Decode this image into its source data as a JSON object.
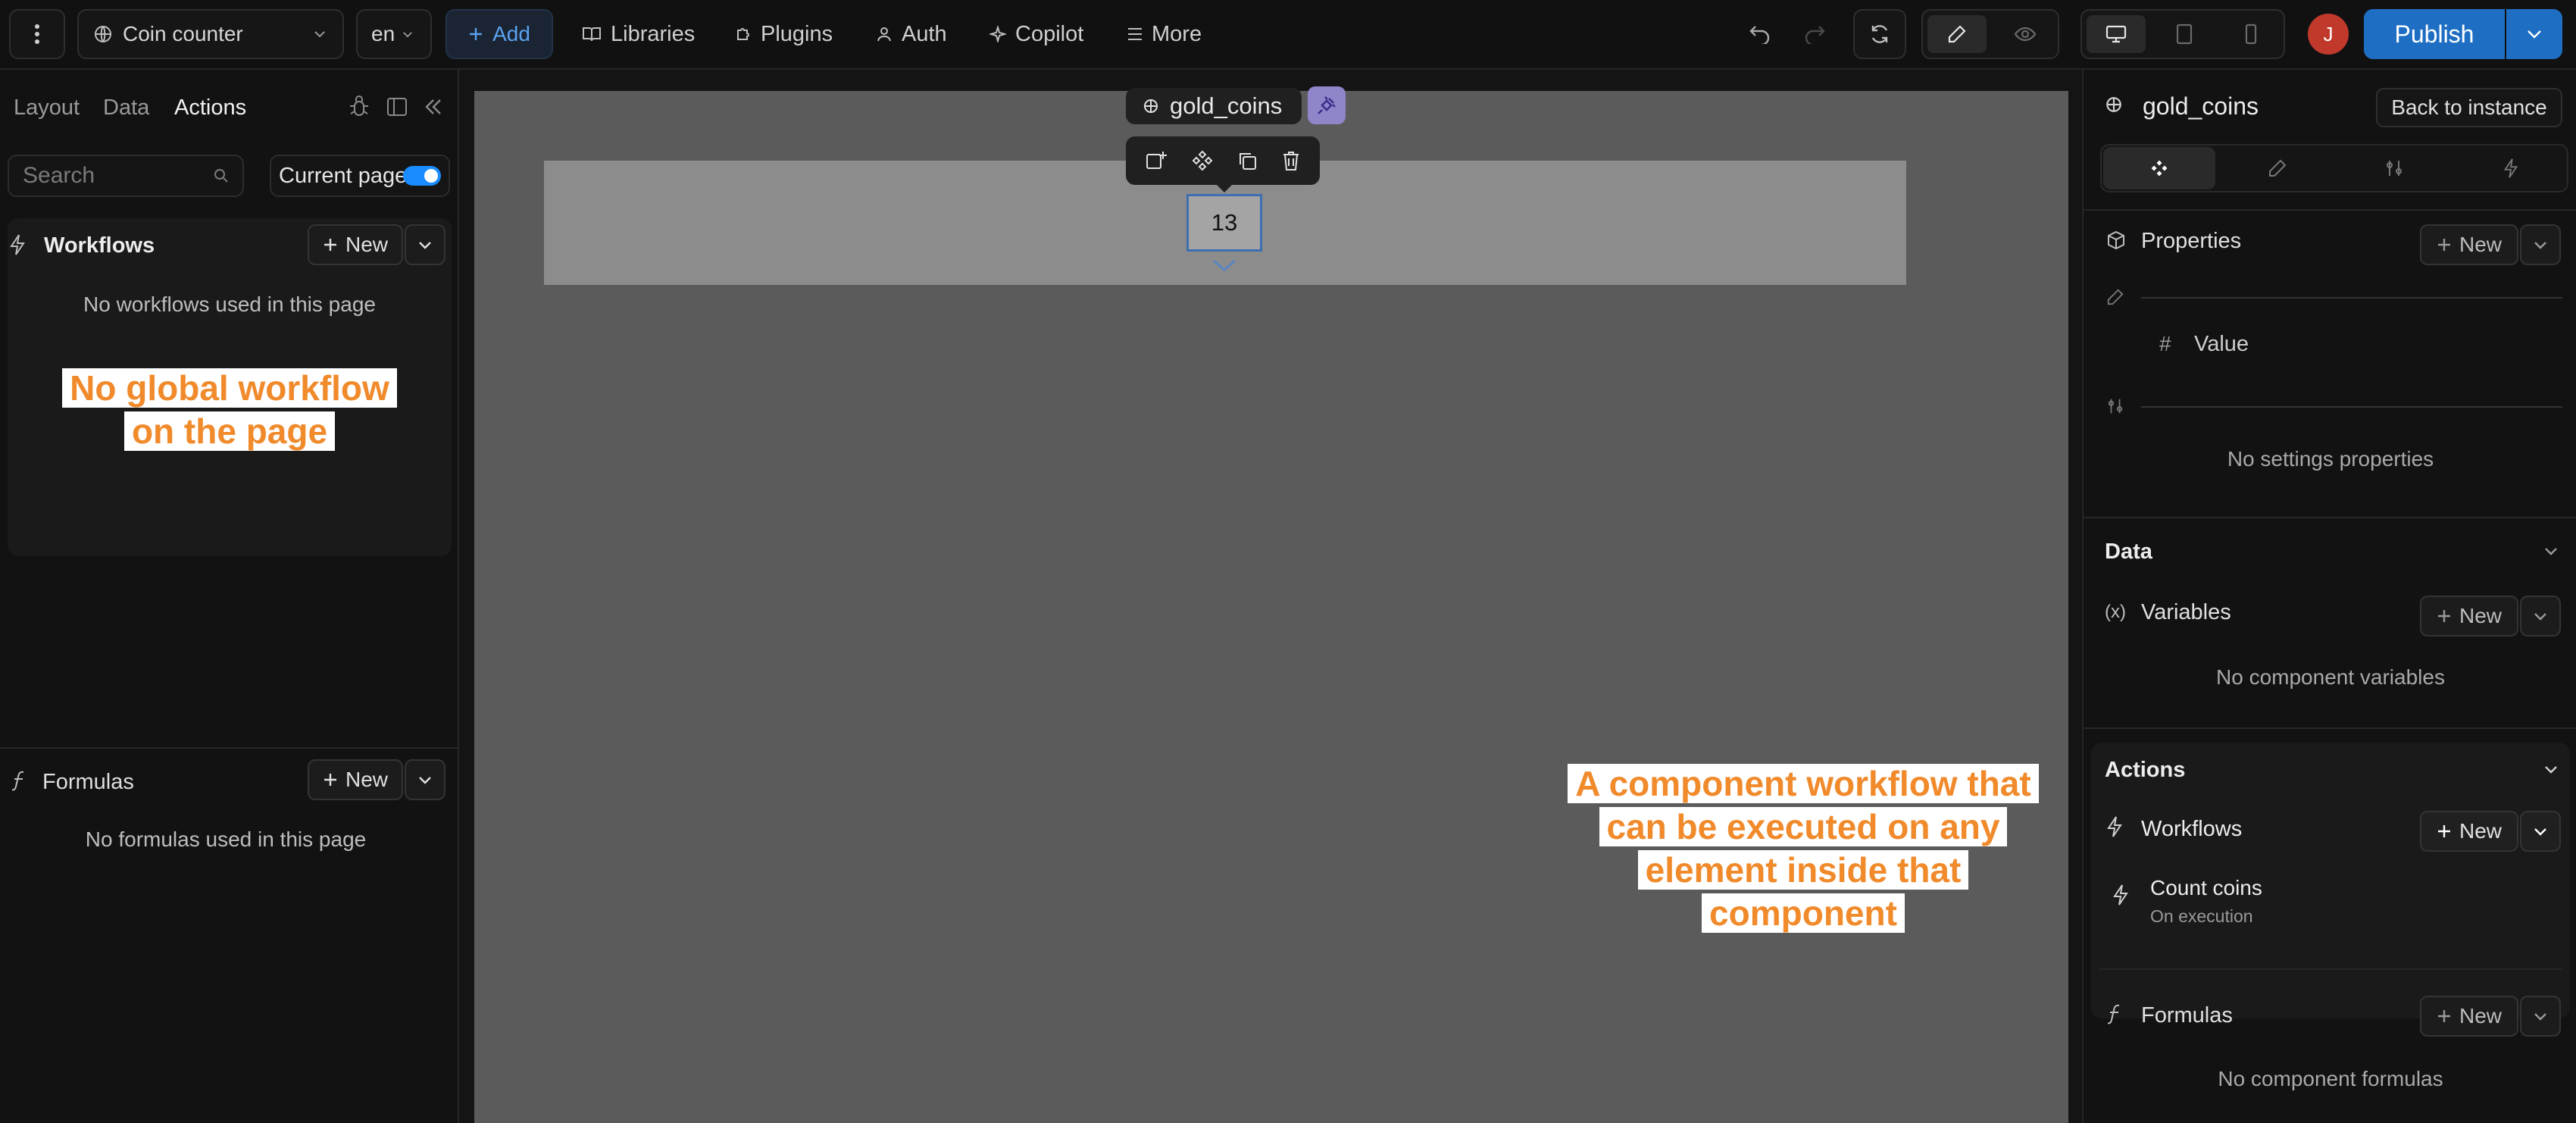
{
  "topbar": {
    "project_name": "Coin counter",
    "language": "en",
    "add_label": "Add",
    "libraries_label": "Libraries",
    "plugins_label": "Plugins",
    "auth_label": "Auth",
    "copilot_label": "Copilot",
    "more_label": "More",
    "avatar_initial": "J",
    "publish_label": "Publish"
  },
  "left_panel": {
    "tabs": [
      "Layout",
      "Data",
      "Actions"
    ],
    "active_tab": "Actions",
    "search_placeholder": "Search",
    "current_page_label": "Current page",
    "current_page_toggle": true,
    "workflows": {
      "title": "Workflows",
      "new_label": "New",
      "empty_text": "No workflows used in this page"
    },
    "annotation_lines": [
      "No global workflow",
      "on the page"
    ],
    "formulas": {
      "title": "Formulas",
      "new_label": "New",
      "empty_text": "No formulas used in this page"
    }
  },
  "canvas": {
    "component_name": "gold_coins",
    "selected_value": "13",
    "annotation_lines": [
      "A component workflow that",
      "can be executed on any",
      "element inside that",
      "component"
    ]
  },
  "right_panel": {
    "component_name": "gold_coins",
    "back_label": "Back to instance",
    "properties": {
      "title": "Properties",
      "new_label": "New",
      "value_label": "Value",
      "empty_settings": "No settings properties"
    },
    "data": {
      "title": "Data",
      "variables_title": "Variables",
      "new_label": "New",
      "empty_text": "No component variables"
    },
    "actions": {
      "title": "Actions",
      "workflows_title": "Workflows",
      "new_label": "New",
      "workflow_name": "Count coins",
      "workflow_trigger": "On execution"
    },
    "formulas": {
      "title": "Formulas",
      "new_label": "New",
      "empty_text": "No component formulas"
    }
  },
  "colors": {
    "accent_blue": "#1e6fc4",
    "annotation_orange": "#f08a2b",
    "avatar_red": "#c0392b",
    "toggle_blue": "#1a8cff"
  }
}
